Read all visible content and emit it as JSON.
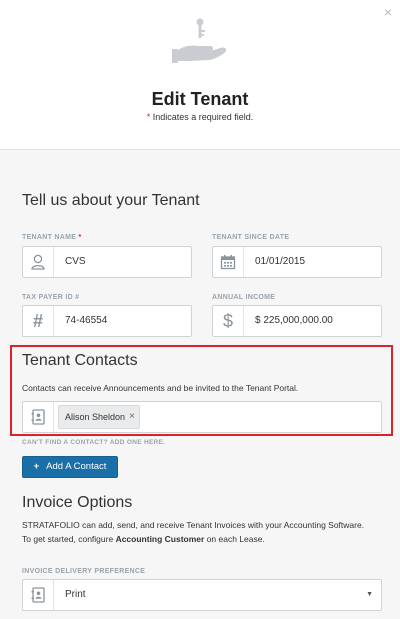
{
  "modal": {
    "close_label": "×",
    "title": "Edit Tenant",
    "required_star": "*",
    "required_note": "Indicates a required field."
  },
  "about": {
    "title": "Tell us about your Tenant",
    "tenant_name": {
      "label": "TENANT NAME",
      "star": "*",
      "value": "CVS",
      "icon": "user-icon"
    },
    "tenant_since": {
      "label": "TENANT SINCE DATE",
      "value": "01/01/2015",
      "icon": "calendar-icon"
    },
    "tax_payer_id": {
      "label": "TAX PAYER ID #",
      "value": "74-46554",
      "icon": "hash-icon"
    },
    "annual_income": {
      "label": "ANNUAL INCOME",
      "value": "$ 225,000,000.00",
      "icon": "dollar-icon"
    }
  },
  "contacts": {
    "title": "Tenant Contacts",
    "description": "Contacts can receive Announcements and be invited to the Tenant Portal.",
    "tags": [
      "Alison Sheldon"
    ],
    "remove_label": "×",
    "icon": "contact-card-icon",
    "highlight_color": "#d9222a",
    "cant_find": "CAN'T FIND A CONTACT? ADD ONE HERE.",
    "add_button": {
      "plus": "+",
      "label": "Add A Contact"
    }
  },
  "invoice": {
    "title": "Invoice Options",
    "desc_line1": "STRATAFOLIO can add, send, and receive Tenant Invoices with your Accounting Software.",
    "desc_line2_prefix": "To get started, configure ",
    "desc_line2_bold": "Accounting Customer",
    "desc_line2_suffix": " on each Lease.",
    "delivery": {
      "label": "INVOICE DELIVERY PREFERENCE",
      "value": "Print",
      "icon": "contact-card-icon"
    }
  },
  "colors": {
    "primary_button": "#1a6fa8",
    "required": "#e02020"
  }
}
